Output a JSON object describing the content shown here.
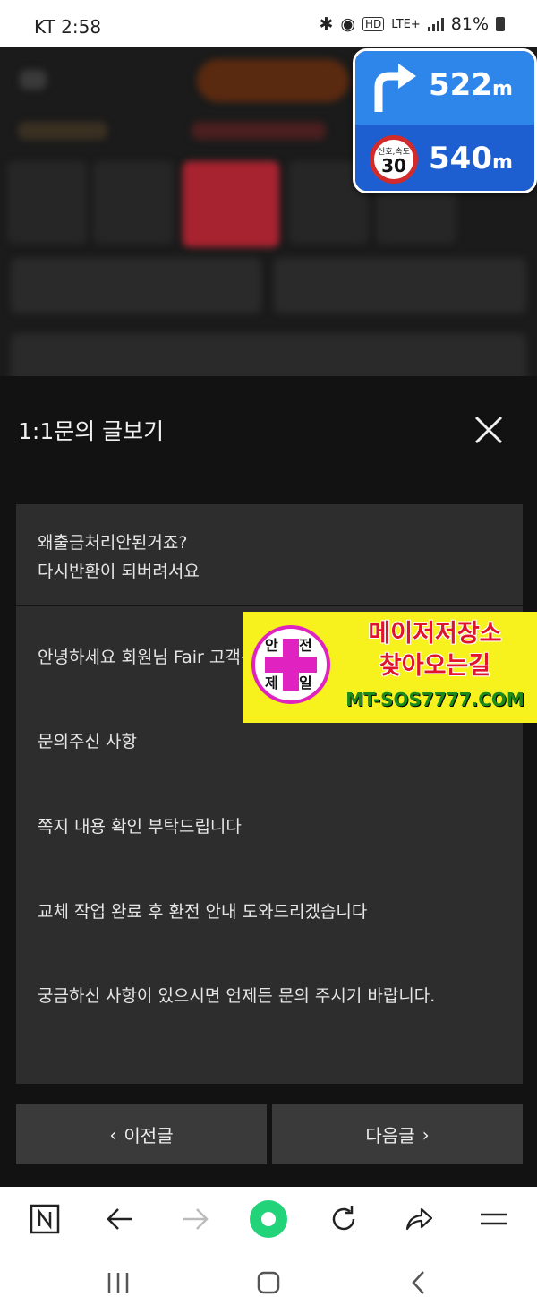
{
  "status_bar": {
    "carrier_time": "KT 2:58",
    "hd_label": "HD",
    "network": "LTE+",
    "battery": "81%"
  },
  "nav_widget": {
    "distance_turn": "522",
    "distance_speed": "540",
    "unit": "m",
    "speed_caption": "신호,속도",
    "speed_limit": "30"
  },
  "modal": {
    "title": "1:1문의 글보기",
    "question_lines": [
      "왜출금처리안된거죠?",
      "다시반환이 되버려서요"
    ],
    "answer_lines": [
      "안녕하세요 회원님 Fair 고객센터입니다",
      "문의주신 사항",
      "쪽지 내용 확인 부탁드립니다",
      "교체 작업 완료 후 환전 안내 도와드리겠습니다",
      "궁금하신 사항이 있으시면 언제든 문의 주시기 바랍니다."
    ],
    "prev_label": "이전글",
    "next_label": "다음글"
  },
  "ad": {
    "logo_chars": [
      "안",
      "전",
      "제",
      "일"
    ],
    "line1": "메이저저장소",
    "line2": "찾아오는길",
    "url": "MT-SOS7777.COM"
  },
  "colors": {
    "modal_bg": "#121212",
    "card_bg": "#2d2d2d",
    "button_bg": "#3a3a3a",
    "nav_blue": "#2f86ea",
    "ad_yellow": "#f7f21e",
    "ad_red": "#e0142a",
    "record_green": "#22d37a"
  },
  "toolbar_icons": [
    "n-home-icon",
    "back-arrow-icon",
    "forward-arrow-icon",
    "green-dot-icon",
    "refresh-icon",
    "share-icon",
    "menu-icon"
  ],
  "system_nav_icons": [
    "recent-apps-icon",
    "home-icon",
    "system-back-icon"
  ]
}
